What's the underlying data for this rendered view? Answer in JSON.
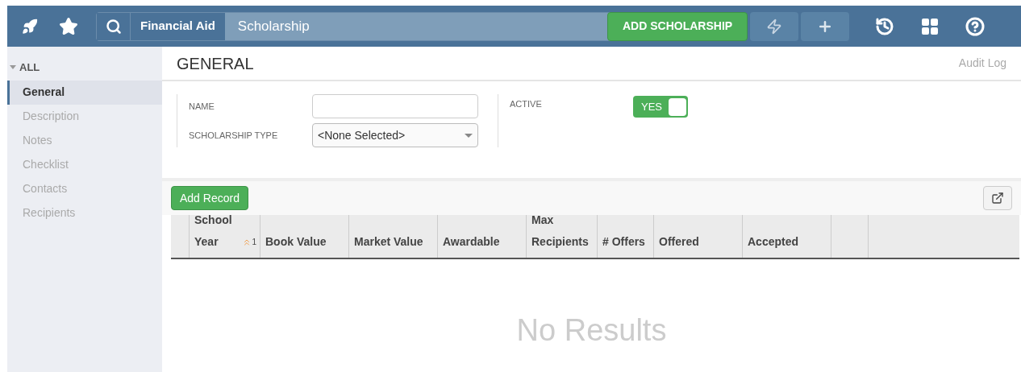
{
  "topbar": {
    "breadcrumb": [
      "Financial Aid",
      "Scholarship"
    ],
    "primary_button": "ADD SCHOLARSHIP"
  },
  "sidebar": {
    "group": "ALL",
    "expanded": true,
    "items": [
      {
        "label": "General",
        "selected": true
      },
      {
        "label": "Description",
        "selected": false
      },
      {
        "label": "Notes",
        "selected": false
      },
      {
        "label": "Checklist",
        "selected": false
      },
      {
        "label": "Contacts",
        "selected": false
      },
      {
        "label": "Recipients",
        "selected": false
      }
    ]
  },
  "section": {
    "title": "GENERAL",
    "link": "Audit Log"
  },
  "form": {
    "name": {
      "label": "NAME"
    },
    "type": {
      "label": "SCHOLARSHIP TYPE",
      "value": "<None Selected>"
    },
    "active": {
      "label": "ACTIVE",
      "on": true,
      "text": "YES"
    }
  },
  "table": {
    "add_button": "Add Record",
    "columns": [
      {
        "lines": [
          "School",
          "Year"
        ],
        "sort_rank": "1"
      },
      {
        "lines": [
          "Book Value"
        ]
      },
      {
        "lines": [
          "Market Value"
        ]
      },
      {
        "lines": [
          "Awardable"
        ]
      },
      {
        "lines": [
          "Max",
          "Recipients"
        ]
      },
      {
        "lines": [
          "# Offers"
        ]
      },
      {
        "lines": [
          "Offered"
        ]
      },
      {
        "lines": [
          "Accepted"
        ]
      }
    ],
    "empty_text": "No Results"
  }
}
